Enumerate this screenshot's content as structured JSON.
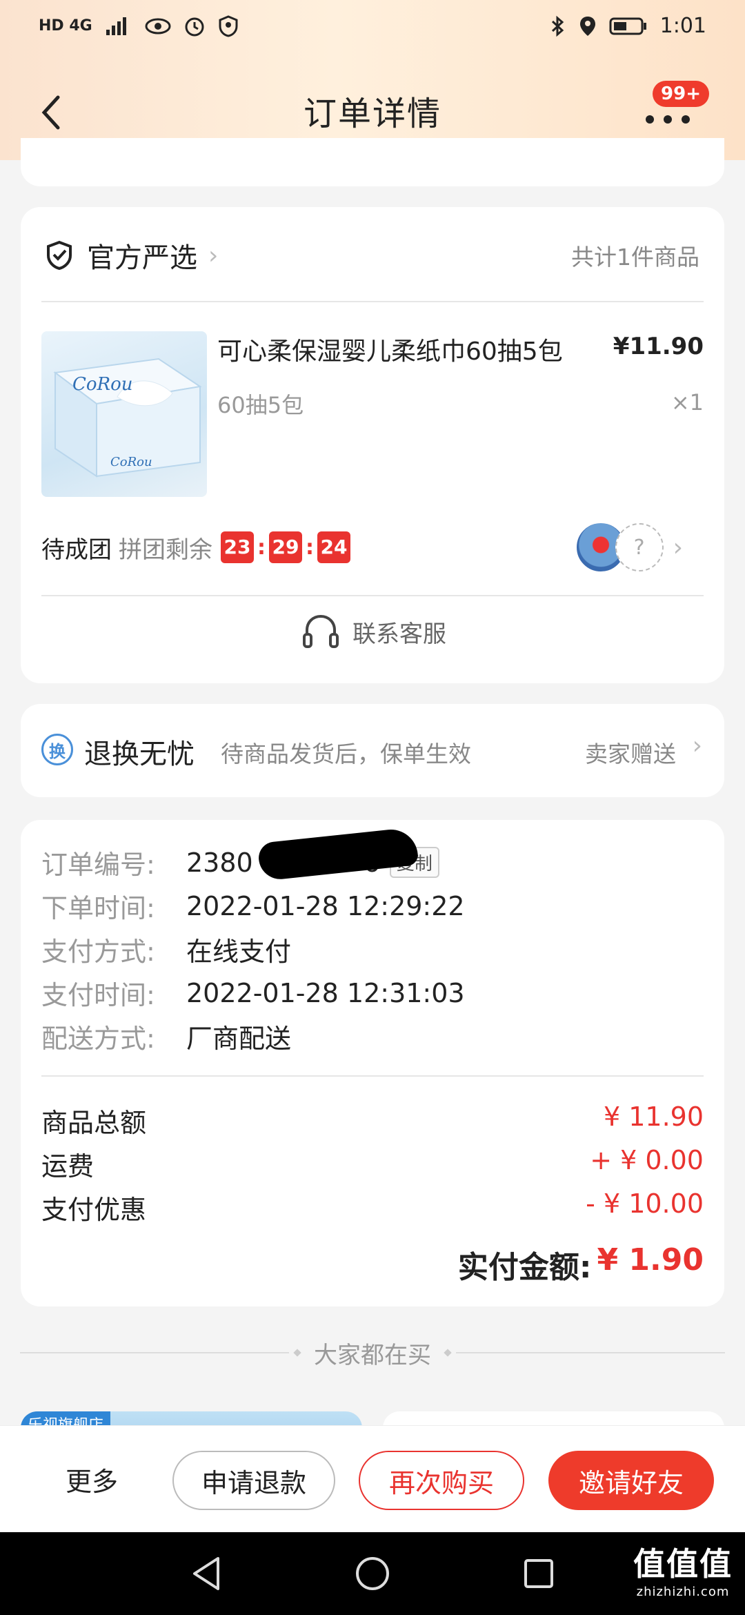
{
  "status_bar": {
    "network": "HD 4G",
    "time": "1:01"
  },
  "nav": {
    "title": "订单详情",
    "badge": "99+"
  },
  "shop": {
    "name": "官方严选",
    "item_count": "共计1件商品"
  },
  "product": {
    "name": "可心柔保湿婴儿柔纸巾60抽5包",
    "price": "¥11.90",
    "spec": "60抽5包",
    "quantity": "×1",
    "image_brand": "CoRou"
  },
  "group_buy": {
    "status": "待成团",
    "remain_label": "拼团剩余",
    "hours": "23",
    "minutes": "29",
    "seconds": "24",
    "sep": ":",
    "unknown_member": "?"
  },
  "service": {
    "label": "联系客服"
  },
  "guarantee": {
    "icon_text": "换",
    "title": "退换无忧",
    "desc": "待商品发货后，保单生效",
    "gift": "卖家赠送"
  },
  "order_info": {
    "rows": [
      {
        "label": "订单编号:",
        "value": "2380",
        "suffix": "6"
      },
      {
        "label": "下单时间:",
        "value": "2022-01-28 12:29:22"
      },
      {
        "label": "支付方式:",
        "value": "在线支付"
      },
      {
        "label": "支付时间:",
        "value": "2022-01-28 12:31:03"
      },
      {
        "label": "配送方式:",
        "value": "厂商配送"
      }
    ],
    "copy_label": "复制"
  },
  "amounts": {
    "rows": [
      {
        "label": "商品总额",
        "value": "¥ 11.90"
      },
      {
        "label": "运费",
        "value": "+ ¥ 0.00"
      },
      {
        "label": "支付优惠",
        "value": "- ¥ 10.00"
      }
    ],
    "total_label": "实付金额:",
    "total_value": "¥ 1.90"
  },
  "recommend": {
    "title": "大家都在买",
    "tag": "乐视旗舰店"
  },
  "actions": {
    "more": "更多",
    "refund": "申请退款",
    "rebuy": "再次购买",
    "invite": "邀请好友"
  },
  "watermark": {
    "logo": "值值值",
    "url": "zhizhizhi.com"
  },
  "colors": {
    "accent": "#e9332f",
    "header_gradient": "#fbe3cf"
  }
}
